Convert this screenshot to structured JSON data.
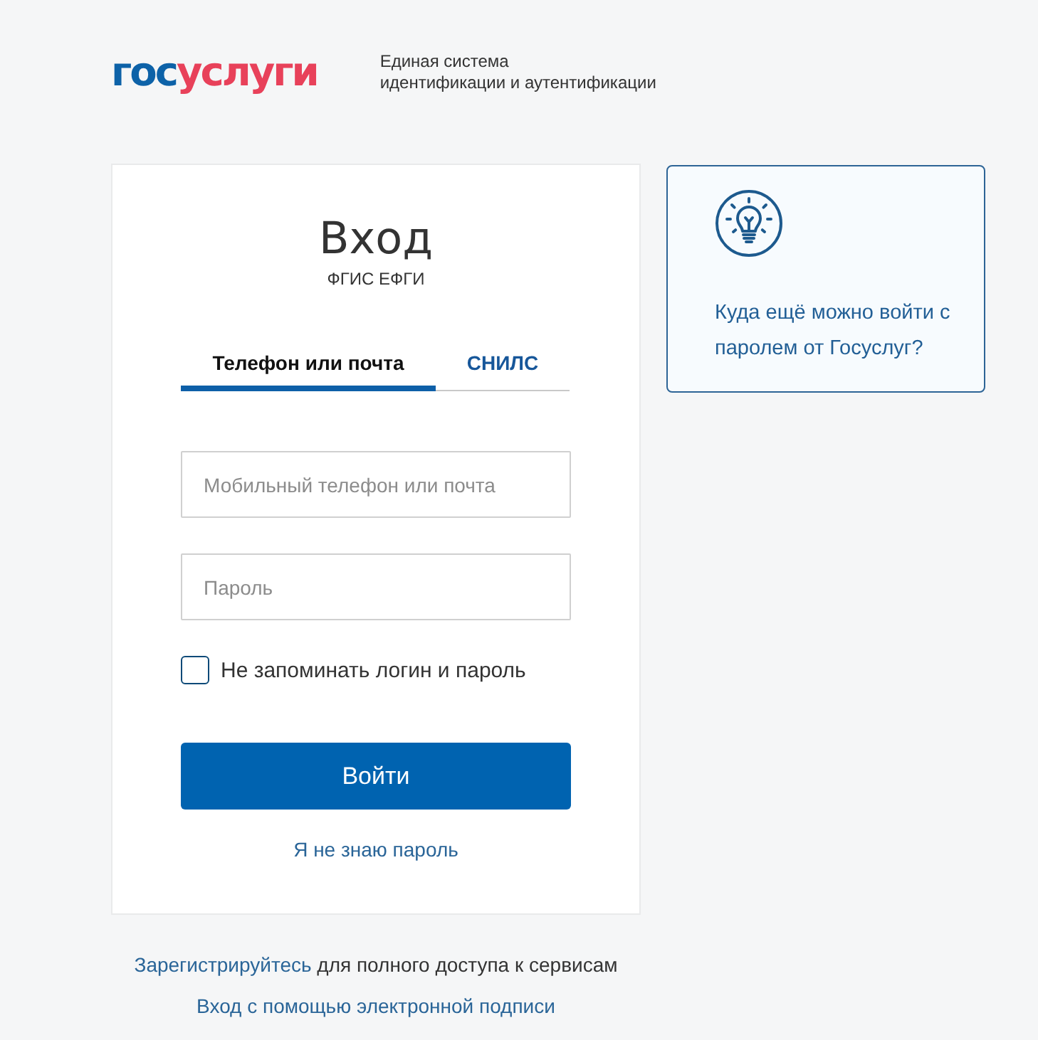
{
  "header": {
    "logo": {
      "part_1": "гос",
      "part_2": "услуги"
    },
    "tagline": [
      "Единая система",
      "идентификации и аутентификации"
    ]
  },
  "login_card": {
    "title": "Вход",
    "subtitle": "ФГИС ЕФГИ",
    "tabs": [
      {
        "label": "Телефон или почта",
        "selected": true
      },
      {
        "label": "СНИЛС",
        "selected": false
      }
    ],
    "fields": [
      {
        "placeholder": "Мобильный телефон или почта"
      },
      {
        "placeholder": "Пароль"
      }
    ],
    "remember": {
      "label": "Не запоминать логин и пароль",
      "checked": false
    },
    "submit_button": "Войти",
    "forgot_link": "Я не знаю пароль"
  },
  "info_card": {
    "text": "Куда ещё можно войти с паролем от Госуслуг?"
  },
  "footer": {
    "register": {
      "link": "Зарегистрируйтесь",
      "text": "для полного доступа к сервисам"
    },
    "signature_link": "Вход с помощью электронной подписи"
  }
}
